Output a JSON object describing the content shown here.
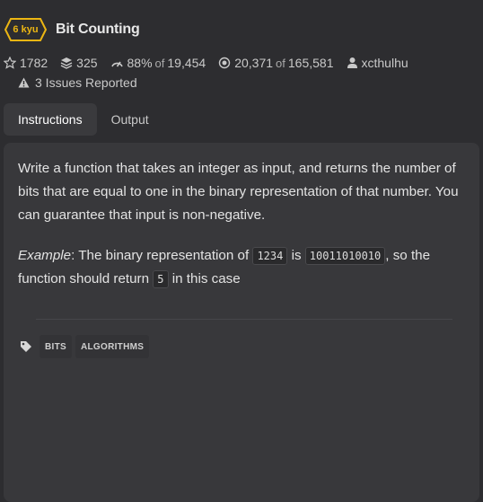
{
  "kata": {
    "rank": "6 kyu",
    "title": "Bit Counting",
    "rank_color": "#ecb613"
  },
  "stats": {
    "stars": "1782",
    "collections": "325",
    "satisfaction": "88%",
    "satisfaction_of": "of",
    "votes": "19,454",
    "completed": "20,371",
    "completed_of": "of",
    "attempts": "165,581",
    "author": "xcthulhu"
  },
  "issues": {
    "label": "3 Issues Reported"
  },
  "tabs": [
    {
      "label": "Instructions",
      "active": true
    },
    {
      "label": "Output",
      "active": false
    }
  ],
  "description": {
    "paragraph1": "Write a function that takes an integer as input, and returns the number of bits that are equal to one in the binary representation of that number. You can guarantee that input is non-negative.",
    "example_label": "Example",
    "example_text_1": ": The binary representation of ",
    "code_input": "1234",
    "example_text_2": " is ",
    "code_binary": "10011010010",
    "example_text_3": ", so the function should return ",
    "code_output": "5",
    "example_text_4": " in this case"
  },
  "tags": [
    "BITS",
    "ALGORITHMS"
  ],
  "icons": [
    "star-icon",
    "collection-icon",
    "satisfaction-icon",
    "completed-icon",
    "user-icon",
    "warning-icon",
    "tag-icon"
  ]
}
